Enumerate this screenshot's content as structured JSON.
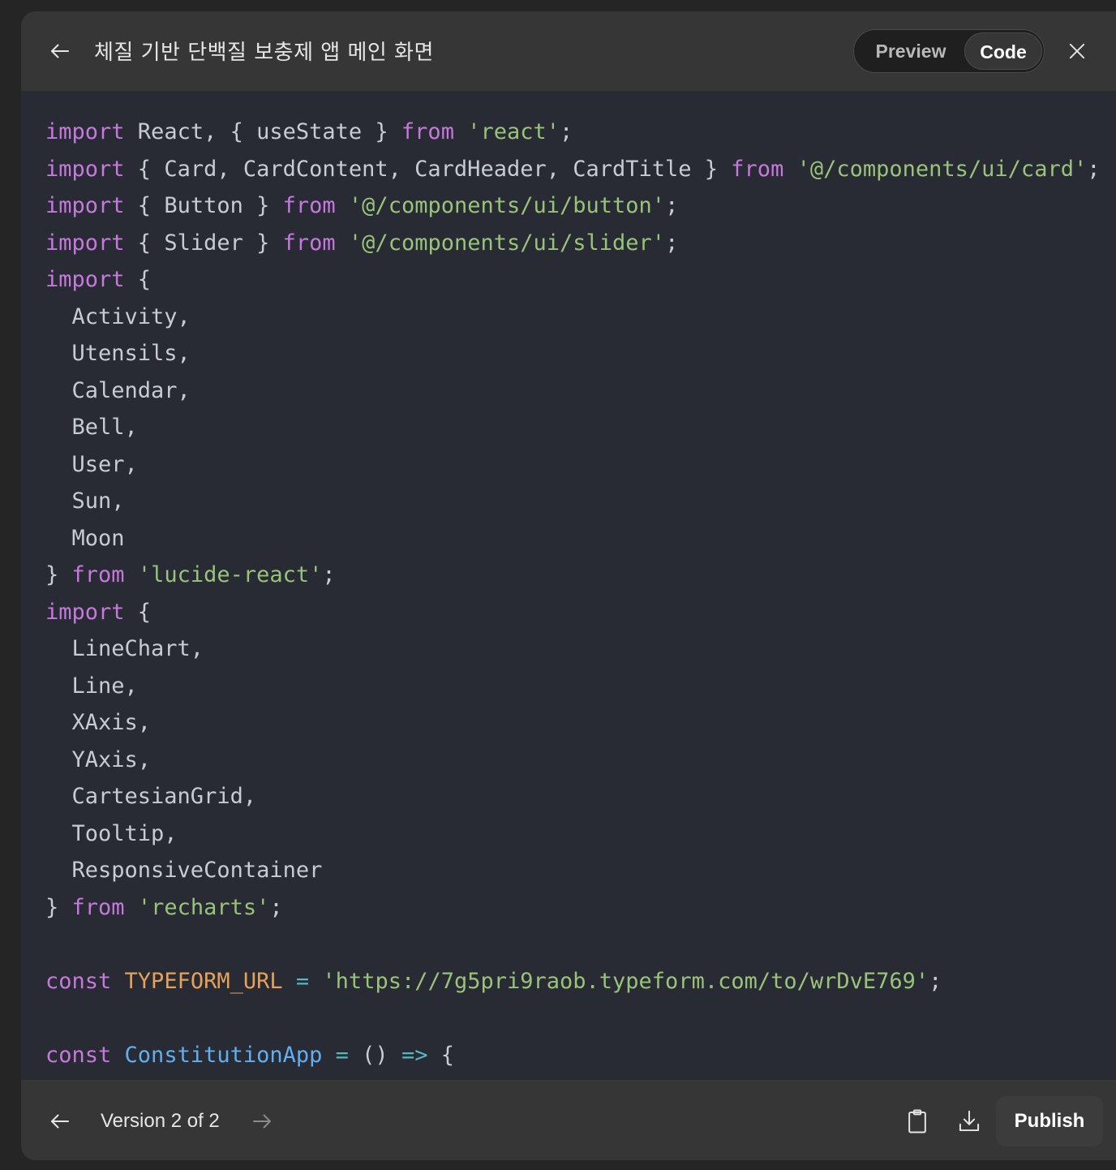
{
  "header": {
    "title": "체질 기반 단백질 보충제 앱 메인 화면",
    "back_icon": "arrow-left-icon",
    "close_icon": "close-icon",
    "toggle": {
      "preview_label": "Preview",
      "code_label": "Code",
      "selected": "Code"
    }
  },
  "code": {
    "language": "jsx",
    "colors": {
      "keyword": "#c678dd",
      "string": "#98c379",
      "constant": "#e5a15a",
      "function": "#61afef",
      "operator": "#56b6c2",
      "text": "#c6cbd4",
      "background": "#282b33"
    },
    "lines": [
      [
        [
          "kw",
          "import"
        ],
        [
          "t",
          " React, { useState } "
        ],
        [
          "kw",
          "from"
        ],
        [
          "t",
          " "
        ],
        [
          "str",
          "'react'"
        ],
        [
          "t",
          ";"
        ]
      ],
      [
        [
          "kw",
          "import"
        ],
        [
          "t",
          " { Card, CardContent, CardHeader, CardTitle } "
        ],
        [
          "kw",
          "from"
        ],
        [
          "t",
          " "
        ],
        [
          "str",
          "'@/components/ui/card'"
        ],
        [
          "t",
          ";"
        ]
      ],
      [
        [
          "kw",
          "import"
        ],
        [
          "t",
          " { Button } "
        ],
        [
          "kw",
          "from"
        ],
        [
          "t",
          " "
        ],
        [
          "str",
          "'@/components/ui/button'"
        ],
        [
          "t",
          ";"
        ]
      ],
      [
        [
          "kw",
          "import"
        ],
        [
          "t",
          " { Slider } "
        ],
        [
          "kw",
          "from"
        ],
        [
          "t",
          " "
        ],
        [
          "str",
          "'@/components/ui/slider'"
        ],
        [
          "t",
          ";"
        ]
      ],
      [
        [
          "kw",
          "import"
        ],
        [
          "t",
          " {"
        ]
      ],
      [
        [
          "t",
          "  Activity,"
        ]
      ],
      [
        [
          "t",
          "  Utensils,"
        ]
      ],
      [
        [
          "t",
          "  Calendar,"
        ]
      ],
      [
        [
          "t",
          "  Bell,"
        ]
      ],
      [
        [
          "t",
          "  User,"
        ]
      ],
      [
        [
          "t",
          "  Sun,"
        ]
      ],
      [
        [
          "t",
          "  Moon"
        ]
      ],
      [
        [
          "t",
          "} "
        ],
        [
          "kw",
          "from"
        ],
        [
          "t",
          " "
        ],
        [
          "str",
          "'lucide-react'"
        ],
        [
          "t",
          ";"
        ]
      ],
      [
        [
          "kw",
          "import"
        ],
        [
          "t",
          " {"
        ]
      ],
      [
        [
          "t",
          "  LineChart,"
        ]
      ],
      [
        [
          "t",
          "  Line,"
        ]
      ],
      [
        [
          "t",
          "  XAxis,"
        ]
      ],
      [
        [
          "t",
          "  YAxis,"
        ]
      ],
      [
        [
          "t",
          "  CartesianGrid,"
        ]
      ],
      [
        [
          "t",
          "  Tooltip,"
        ]
      ],
      [
        [
          "t",
          "  ResponsiveContainer"
        ]
      ],
      [
        [
          "t",
          "} "
        ],
        [
          "kw",
          "from"
        ],
        [
          "t",
          " "
        ],
        [
          "str",
          "'recharts'"
        ],
        [
          "t",
          ";"
        ]
      ],
      [],
      [
        [
          "kw",
          "const"
        ],
        [
          "t",
          " "
        ],
        [
          "con",
          "TYPEFORM_URL"
        ],
        [
          "t",
          " "
        ],
        [
          "op",
          "="
        ],
        [
          "t",
          " "
        ],
        [
          "str",
          "'https://7g5pri9raob.typeform.com/to/wrDvE769'"
        ],
        [
          "t",
          ";"
        ]
      ],
      [],
      [
        [
          "kw",
          "const"
        ],
        [
          "t",
          " "
        ],
        [
          "fn",
          "ConstitutionApp"
        ],
        [
          "t",
          " "
        ],
        [
          "op",
          "="
        ],
        [
          "t",
          " () "
        ],
        [
          "op",
          "=>"
        ],
        [
          "t",
          " {"
        ]
      ]
    ]
  },
  "footer": {
    "prev_icon": "arrow-left-icon",
    "version_label": "Version 2 of 2",
    "next_icon": "arrow-right-icon",
    "copy_icon": "clipboard-icon",
    "download_icon": "download-icon",
    "publish_label": "Publish"
  }
}
